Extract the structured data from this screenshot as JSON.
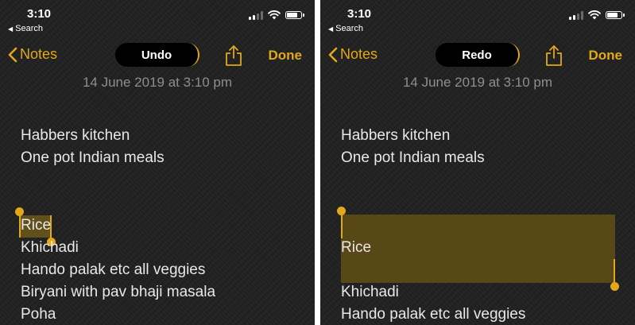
{
  "left_screen": {
    "status": {
      "time": "3:10",
      "back_label": "Search"
    },
    "nav": {
      "back_label": "Notes",
      "pill_label": "Undo",
      "done_label": "Done"
    },
    "date": "14 June 2019 at 3:10 pm",
    "lines": [
      "Habbers kitchen",
      "One pot Indian meals",
      "Rice",
      "Khichadi",
      "Hando palak etc all veggies",
      "Biryani with pav bhaji masala",
      "Poha"
    ]
  },
  "right_screen": {
    "status": {
      "time": "3:10",
      "back_label": "Search"
    },
    "nav": {
      "back_label": "Notes",
      "pill_label": "Redo",
      "done_label": "Done"
    },
    "date": "14 June 2019 at 3:10 pm",
    "lines": [
      "Habbers kitchen",
      "One pot Indian meals",
      "Rice",
      "Khichadi",
      "Hando palak etc all veggies"
    ]
  },
  "icons": {
    "signal": "cellular-signal-icon",
    "wifi": "wifi-icon",
    "battery": "battery-icon",
    "back_chevron": "chevron-left-icon",
    "share": "share-icon"
  },
  "colors": {
    "accent": "#e3a81a",
    "background": "#202020",
    "text": "#e8e8e8",
    "date_text": "#8e8e8e",
    "selection": "#6e5814"
  }
}
